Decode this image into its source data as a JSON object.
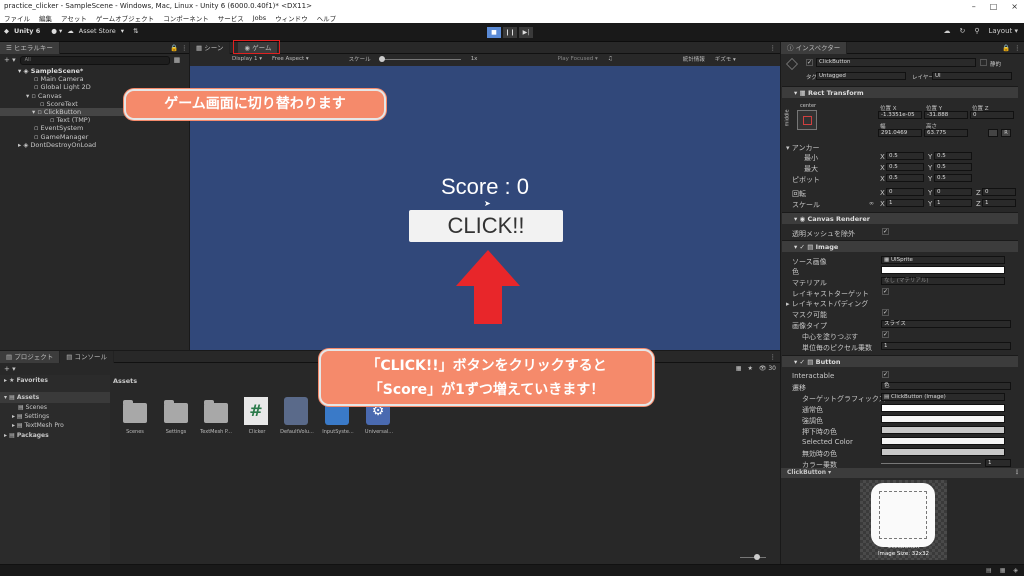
{
  "window": {
    "title": "practice_clicker - SampleScene - Windows, Mac, Linux - Unity 6 (6000.0.40f1)* <DX11>"
  },
  "menu": [
    "ファイル",
    "編集",
    "アセット",
    "ゲームオブジェクト",
    "コンポーネント",
    "サービス",
    "Jobs",
    "ウィンドウ",
    "ヘルプ"
  ],
  "toolbar": {
    "unity": "Unity 6",
    "asset_store": "Asset Store",
    "layout": "Layout"
  },
  "hierarchy": {
    "tab": "ヒエラルキー",
    "search": "All",
    "items": [
      "SampleScene*",
      "Main Camera",
      "Global Light 2D",
      "Canvas",
      "ScoreText",
      "ClickButton",
      "Text (TMP)",
      "EventSystem",
      "GameManager",
      "DontDestroyOnLoad"
    ]
  },
  "game_view": {
    "tab_scene": "シーン",
    "tab_game": "ゲーム",
    "display": "Display 1",
    "aspect": "Free Aspect",
    "scale_label": "スケール",
    "scale_value": "1x",
    "play_focused": "Play Focused",
    "stats": "統計情報",
    "gizmos": "ギズモ",
    "score_text": "Score : 0",
    "button_text": "CLICK!!"
  },
  "callouts": {
    "top": "ゲーム画面に切り替わります",
    "bottom_line1": "「CLICK!!」ボタンをクリックすると",
    "bottom_line2": "「Score」が1ずつ増えていきます！"
  },
  "project": {
    "tab_project": "プロジェクト",
    "tab_console": "コンソール",
    "favorites": "Favorites",
    "assets": "Assets",
    "packages": "Packages",
    "folders": [
      "Scenes",
      "Settings",
      "TextMesh Pro"
    ],
    "breadcrumb": "Assets",
    "count": "30",
    "items": [
      "Scenes",
      "Settings",
      "TextMesh P...",
      "Clicker",
      "DefaultVolu...",
      "InputSyste...",
      "Universal..."
    ]
  },
  "inspector": {
    "tab": "インスペクター",
    "object": "ClickButton",
    "static": "静的",
    "tag_label": "タグ",
    "tag": "Untagged",
    "layer_label": "レイヤー",
    "layer": "UI",
    "rect_transform": "Rect Transform",
    "anchor_center": "center",
    "anchor_middle": "middle",
    "pos_x_label": "位置 X",
    "pos_y_label": "位置 Y",
    "pos_z_label": "位置 Z",
    "pos_x": "-1.3351e-05",
    "pos_y": "-31.888",
    "pos_z": "0",
    "width_label": "幅",
    "height_label": "高さ",
    "width": "291.0469",
    "height": "63.775",
    "anchors": "アンカー",
    "min": "最小",
    "max": "最大",
    "pivot": "ピボット",
    "rotation": "回転",
    "scale": "スケール",
    "min_x": "0.5",
    "min_y": "0.5",
    "max_x": "0.5",
    "max_y": "0.5",
    "pivot_x": "0.5",
    "pivot_y": "0.5",
    "rot_x": "0",
    "rot_y": "0",
    "rot_z": "0",
    "scale_x": "1",
    "scale_y": "1",
    "scale_z": "1",
    "canvas_renderer": "Canvas Renderer",
    "cull_transparent": "透明メッシュを除外",
    "image": "Image",
    "source_image_label": "ソース画像",
    "source_image": "UISprite",
    "color_label": "色",
    "material_label": "マテリアル",
    "material": "なし (マテリアル)",
    "raycast_target": "レイキャストターゲット",
    "raycast_padding": "レイキャストパディング",
    "maskable": "マスク可能",
    "image_type_label": "画像タイプ",
    "image_type": "スライス",
    "fill_center": "中心を塗りつぶす",
    "pixels_per_unit_label": "単位毎のピクセル乗数",
    "pixels_per_unit": "1",
    "button": "Button",
    "interactable": "Interactable",
    "transition_label": "遷移",
    "transition": "色",
    "target_graphic_label": "ターゲットグラフィックス",
    "target_graphic": "ClickButton (Image)",
    "normal_color": "通常色",
    "highlighted_color": "強調色",
    "pressed_color": "押下時の色",
    "selected_color": "Selected Color",
    "disabled_color": "無効時の色",
    "color_multiplier": "カラー乗数",
    "color_multiplier_value": "1",
    "preview_title": "ClickButton",
    "preview_name": "ClickButton",
    "preview_size": "Image Size: 32x32"
  }
}
